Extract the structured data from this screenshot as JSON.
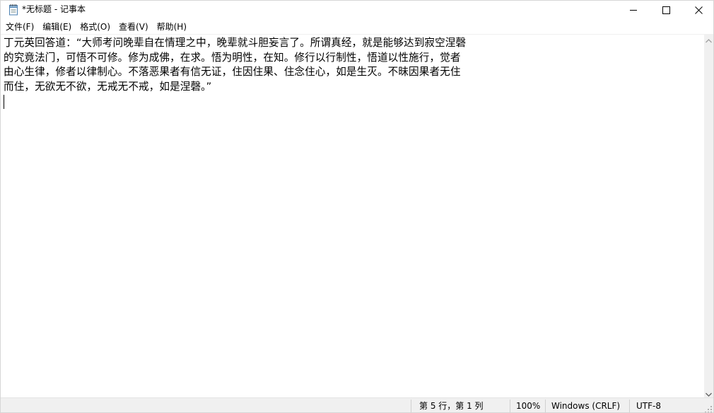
{
  "window": {
    "title": "*无标题 - 记事本"
  },
  "menu": {
    "items": [
      {
        "label": "文件(F)"
      },
      {
        "label": "编辑(E)"
      },
      {
        "label": "格式(O)"
      },
      {
        "label": "查看(V)"
      },
      {
        "label": "帮助(H)"
      }
    ]
  },
  "editor": {
    "text": "丁元英回答道：“大师考问晚辈自在情理之中，晚辈就斗胆妄言了。所谓真经，就是能够达到寂空涅磬的究竟法门，可悟不可修。修为成佛，在求。悟为明性，在知。修行以行制性，悟道以性施行，觉者由心生律，修者以律制心。不落恶果者有信无证，住因住果、住念住心，如是生灭。不昧因果者无住而住，无欲无不欲，无戒无不戒，如是涅磬。”"
  },
  "status": {
    "position": "第 5 行，第 1 列",
    "zoom": "100%",
    "line_ending": "Windows (CRLF)",
    "encoding": "UTF-8"
  },
  "icons": {
    "app": "notepad-icon",
    "minimize": "minimize-icon",
    "maximize": "maximize-icon",
    "close": "close-icon",
    "scroll_up": "scroll-up-arrow-icon",
    "scroll_down": "scroll-down-arrow-icon",
    "grip": "resize-grip-icon"
  }
}
